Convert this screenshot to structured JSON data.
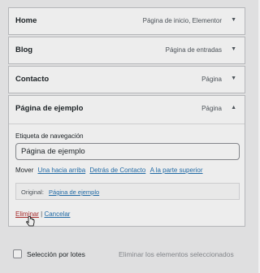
{
  "menu_items": [
    {
      "title": "Home",
      "type": "Página de inicio, Elementor"
    },
    {
      "title": "Blog",
      "type": "Página de entradas"
    },
    {
      "title": "Contacto",
      "type": "Página"
    }
  ],
  "expanded_item": {
    "title": "Página de ejemplo",
    "type": "Página",
    "nav_label": "Etiqueta de navegación",
    "nav_value": "Página de ejemplo",
    "move_label": "Mover",
    "move_links": [
      "Una hacia arriba",
      "Detrás de Contacto",
      "A la parte superior"
    ],
    "original_label": "Original:",
    "original_link": "Página de ejemplo",
    "delete_label": "Eliminar",
    "separator": "|",
    "cancel_label": "Cancelar"
  },
  "bulk": {
    "select_label": "Selección por lotes",
    "delete_label": "Eliminar los elementos seleccionados"
  },
  "icons": {
    "collapse": "arrow-down-icon",
    "expand": "arrow-up-icon",
    "pointer": "hand-cursor-icon"
  }
}
